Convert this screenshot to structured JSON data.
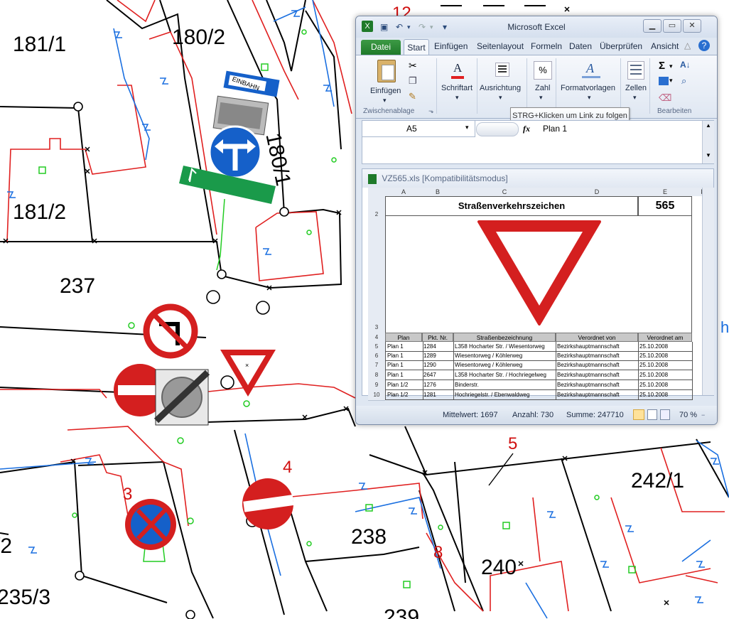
{
  "map": {
    "parcels": [
      "181/1",
      "180/2",
      "180/1",
      "181/2",
      "237",
      "242/1",
      "238",
      "240",
      "235/3",
      "239",
      "/2"
    ],
    "markers": [
      "12",
      "3",
      "4",
      "5",
      "8"
    ],
    "signs": {
      "einbahn_text": "EINBAHN"
    }
  },
  "excel": {
    "window_title": "Microsoft Excel",
    "tabs": [
      "Datei",
      "Start",
      "Einfügen",
      "Seitenlayout",
      "Formeln",
      "Daten",
      "Überprüfen",
      "Ansicht"
    ],
    "ribbon": {
      "einfuegen": "Einfügen",
      "schriftart": "Schriftart",
      "ausrichtung": "Ausrichtung",
      "zahl": "Zahl",
      "formatvorlagen": "Formatvorlagen",
      "zellen": "Zellen",
      "zwischenablage": "Zwischenablage",
      "bearbeiten": "Bearbeiten",
      "percent_glyph": "%",
      "sigma_glyph": "Σ"
    },
    "tooltip": "STRG+Klicken um Link zu folgen",
    "namebox": "A5",
    "fx_label": "fx",
    "formula_value": "Plan 1",
    "document": {
      "filename": "VZ565.xls  [Kompatibilitätsmodus]",
      "columns": [
        "A",
        "B",
        "C",
        "D",
        "E",
        "F"
      ],
      "row_numbers": [
        "2",
        "3",
        "4",
        "5",
        "6",
        "7",
        "8",
        "9",
        "10"
      ],
      "sheet_title": "Straßenverkehrszeichen",
      "sign_number": "565",
      "headers": [
        "Plan",
        "Pkt. Nr.",
        "Straßenbezeichnung",
        "Verordnet von",
        "Verordnet am"
      ],
      "rows": [
        [
          "Plan 1",
          "1284",
          "L358 Hocharter Str. / Wiesentorweg",
          "Bezirkshauptmannschaft",
          "25.10.2008"
        ],
        [
          "Plan 1",
          "1289",
          "Wiesentorweg / Köhlerweg",
          "Bezirkshauptmannschaft",
          "25.10.2008"
        ],
        [
          "Plan 1",
          "1290",
          "Wiesentorweg / Köhlerweg",
          "Bezirkshauptmannschaft",
          "25.10.2008"
        ],
        [
          "Plan 1",
          "2647",
          "L358 Hocharter Str. / Hochriegelweg",
          "Bezirkshauptmannschaft",
          "25.10.2008"
        ],
        [
          "Plan 1/2",
          "1276",
          "Binderstr.",
          "Bezirkshauptmannschaft",
          "25.10.2008"
        ],
        [
          "Plan 1/2",
          "1281",
          "Hochriegelstr. / Ebenwaldweg",
          "Bezirkshauptmannschaft",
          "25.10.2008"
        ]
      ]
    },
    "status": {
      "mittelwert": "Mittelwert: 1697",
      "anzahl": "Anzahl: 730",
      "summe": "Summe: 247710",
      "zoom": "70 %"
    }
  },
  "colors": {
    "parcel_line": "#000000",
    "boundary_red": "#e02020",
    "boundary_blue": "#1a6fe0",
    "marker_green": "#22cc22",
    "excel_green": "#1f7a2a",
    "sign_red": "#d41f1f",
    "sign_blue": "#1560c9"
  }
}
